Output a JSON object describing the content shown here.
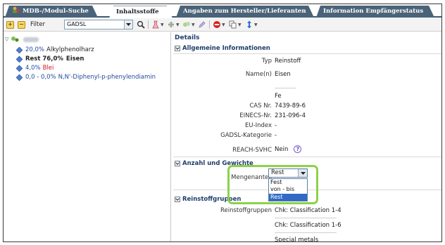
{
  "tabs": [
    {
      "label": "MDB-/Modul-Suche",
      "active": false,
      "icon": "user-module-icon"
    },
    {
      "label": "Inhaltsstoffe",
      "active": true
    },
    {
      "label": "Angaben zum Hersteller/Lieferanten",
      "active": false
    },
    {
      "label": "Information Empfängerstatus",
      "active": false
    }
  ],
  "toolbar": {
    "filter_label": "Filter",
    "filter_value": "GADSL",
    "icons": [
      "expand-icon",
      "collapse-icon",
      "search-icon",
      "flask-icon",
      "add-substance-icon",
      "add-material-icon",
      "edit-icon",
      "delete-icon",
      "copy-icon",
      "move-icon"
    ]
  },
  "tree": {
    "root_icon": "tree-root-icon",
    "items": [
      {
        "pct": "20,0%",
        "name": "Alkylphenolharz",
        "style": "normal"
      },
      {
        "pct": "Rest 76,0%",
        "name": "Eisen",
        "style": "bold"
      },
      {
        "pct": "4,0%",
        "name": "Blei",
        "style": "red"
      },
      {
        "pct": "0,0 - 0,0%",
        "name": "N,N'-Diphenyl-p-phenylendiamin",
        "style": "blue"
      }
    ]
  },
  "details": {
    "title": "Details",
    "general": {
      "header": "Allgemeine Informationen",
      "typ_label": "Typ",
      "typ_value": "Reinstoff",
      "name_label": "Name(n)",
      "name_value": "Eisen",
      "symbol_value": "Fe",
      "cas_label": "CAS Nr.",
      "cas_value": "7439-89-6",
      "einecs_label": "EINECS-Nr.",
      "einecs_value": "231-096-4",
      "eu_label": "EU-Index",
      "eu_value": "-",
      "gadsl_label": "GADSL-Kategorie",
      "gadsl_value": "-",
      "reach_label": "REACH-SVHC",
      "reach_value": "Nein",
      "help_glyph": "?"
    },
    "weights": {
      "header": "Anzahl und Gewichte",
      "menge_label": "Mengenanteil",
      "menge_value": "Rest",
      "options": [
        "Fest",
        "von - bis",
        "Rest"
      ],
      "selected_option": "Rest"
    },
    "groups": {
      "header": "Reinstoffgruppen",
      "label": "Reinstoffgruppen",
      "values": [
        "Chk: Classification 1-4",
        "Chk: Classification 1-6",
        "Special metals"
      ]
    }
  },
  "colors": {
    "accent_tab": "#4a6378",
    "highlight": "#8cd24a",
    "selected_option": "#316ac5",
    "red_text": "#d01515"
  }
}
